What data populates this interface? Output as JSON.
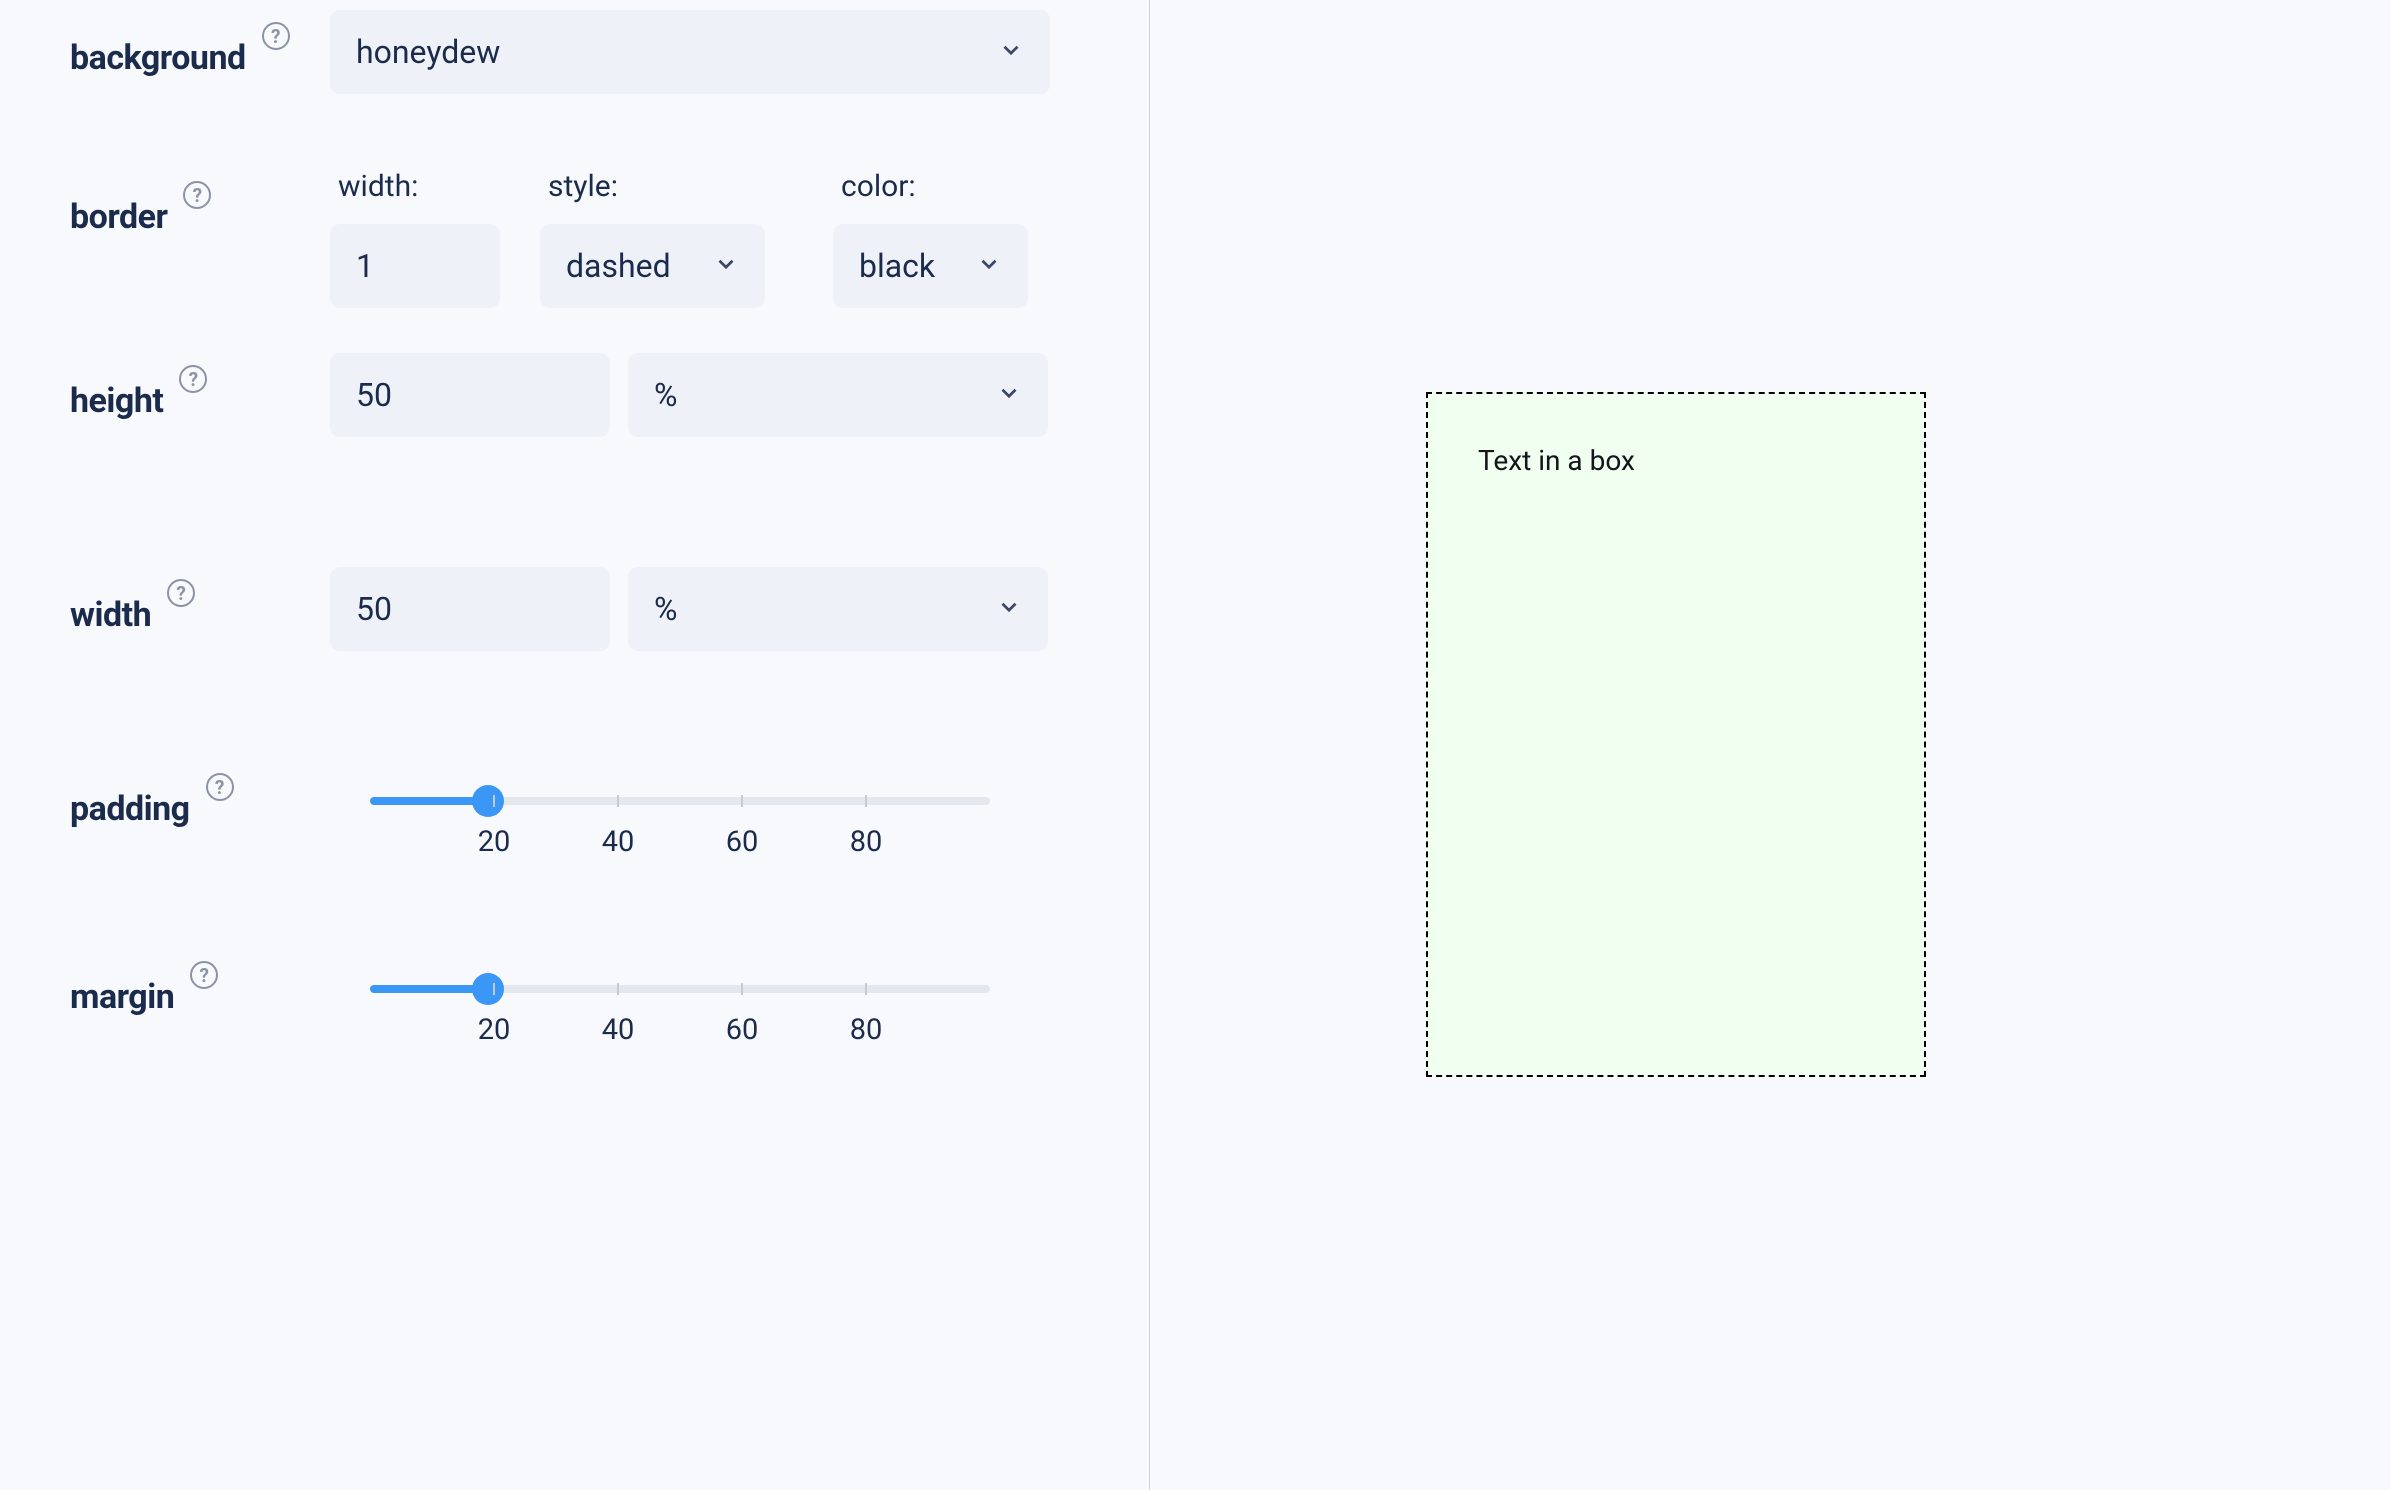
{
  "controls": {
    "background": {
      "label": "background",
      "value": "honeydew"
    },
    "border": {
      "label": "border",
      "sub_width_label": "width:",
      "sub_style_label": "style:",
      "sub_color_label": "color:",
      "width_value": "1",
      "style_value": "dashed",
      "color_value": "black"
    },
    "height": {
      "label": "height",
      "value": "50",
      "unit": "%"
    },
    "width": {
      "label": "width",
      "value": "50",
      "unit": "%"
    },
    "padding": {
      "label": "padding",
      "value": 19,
      "ticks": [
        "20",
        "40",
        "60",
        "80"
      ]
    },
    "margin": {
      "label": "margin",
      "value": 19,
      "ticks": [
        "20",
        "40",
        "60",
        "80"
      ]
    }
  },
  "preview": {
    "text": "Text in a box"
  },
  "help_glyph": "?"
}
